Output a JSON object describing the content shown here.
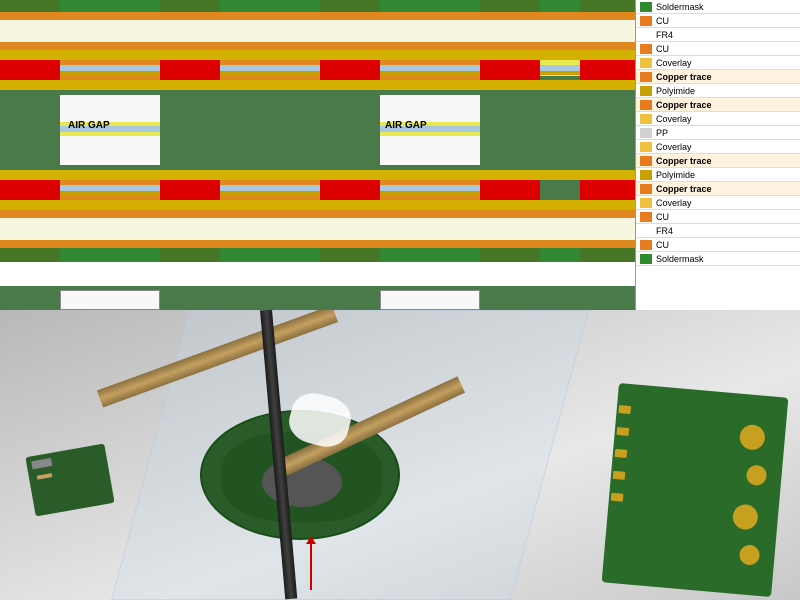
{
  "diagram": {
    "air_gap_1": "AIR GAP",
    "air_gap_2": "AIR GAP"
  },
  "legend": {
    "items": [
      {
        "label": "Soldermask",
        "color": "#2e8b2e"
      },
      {
        "label": "CU",
        "color": "#e87b1e"
      },
      {
        "label": "FR4",
        "color": "#ffffff"
      },
      {
        "label": "CU",
        "color": "#e87b1e"
      },
      {
        "label": "Coverlay",
        "color": "#f0c040"
      },
      {
        "label": "Copper trace",
        "color": "#e87b1e"
      },
      {
        "label": "Polyimide",
        "color": "#c8a000"
      },
      {
        "label": "Copper trace",
        "color": "#e87b1e"
      },
      {
        "label": "Coverlay",
        "color": "#f0c040"
      },
      {
        "label": "PP",
        "color": "#d0d0d0"
      },
      {
        "label": "Coverlay",
        "color": "#f0c040"
      },
      {
        "label": "Copper trace",
        "color": "#e87b1e"
      },
      {
        "label": "Polyimide",
        "color": "#c8a000"
      },
      {
        "label": "Copper trace",
        "color": "#e87b1e"
      },
      {
        "label": "Coverlay",
        "color": "#f0c040"
      },
      {
        "label": "CU",
        "color": "#e87b1e"
      },
      {
        "label": "FR4",
        "color": "#ffffff"
      },
      {
        "label": "CU",
        "color": "#e87b1e"
      },
      {
        "label": "Soldermask",
        "color": "#2e8b2e"
      }
    ]
  }
}
